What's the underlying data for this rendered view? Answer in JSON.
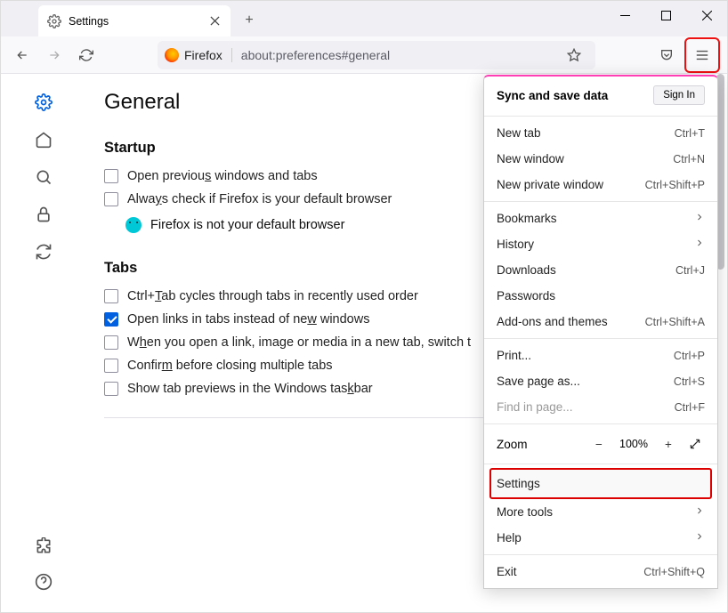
{
  "tab": {
    "title": "Settings"
  },
  "toolbar": {
    "firefox_label": "Firefox",
    "url": "about:preferences#general"
  },
  "page": {
    "title": "General",
    "sections": {
      "startup": {
        "heading": "Startup",
        "open_previous_pre": "Open previou",
        "open_previous_u": "s",
        "open_previous_post": " windows and tabs",
        "always_check_pre": "Alwa",
        "always_check_u": "y",
        "always_check_post": "s check if Firefox is your default browser",
        "not_default": "Firefox is not your default browser"
      },
      "tabs": {
        "heading": "Tabs",
        "ctrltab_pre": "Ctrl+",
        "ctrltab_u": "T",
        "ctrltab_post": "ab cycles through tabs in recently used order",
        "openlinks_pre": "Open links in tabs instead of ne",
        "openlinks_u": "w",
        "openlinks_post": " windows",
        "switch_pre": "W",
        "switch_u": "h",
        "switch_post": "en you open a link, image or media in a new tab, switch t",
        "confirm_pre": "Confir",
        "confirm_u": "m",
        "confirm_post": " before closing multiple tabs",
        "taskbar_pre": "Show tab previews in the Windows tas",
        "taskbar_u": "k",
        "taskbar_post": "bar"
      }
    }
  },
  "menu": {
    "sync_head": "Sync and save data",
    "sign_in": "Sign In",
    "new_tab": "New tab",
    "new_tab_sc": "Ctrl+T",
    "new_window": "New window",
    "new_window_sc": "Ctrl+N",
    "new_private": "New private window",
    "new_private_sc": "Ctrl+Shift+P",
    "bookmarks": "Bookmarks",
    "history": "History",
    "downloads": "Downloads",
    "downloads_sc": "Ctrl+J",
    "passwords": "Passwords",
    "addons": "Add-ons and themes",
    "addons_sc": "Ctrl+Shift+A",
    "print": "Print...",
    "print_sc": "Ctrl+P",
    "save_as": "Save page as...",
    "save_as_sc": "Ctrl+S",
    "find": "Find in page...",
    "find_sc": "Ctrl+F",
    "zoom": "Zoom",
    "zoom_val": "100%",
    "settings": "Settings",
    "more_tools": "More tools",
    "help": "Help",
    "exit": "Exit",
    "exit_sc": "Ctrl+Shift+Q"
  }
}
